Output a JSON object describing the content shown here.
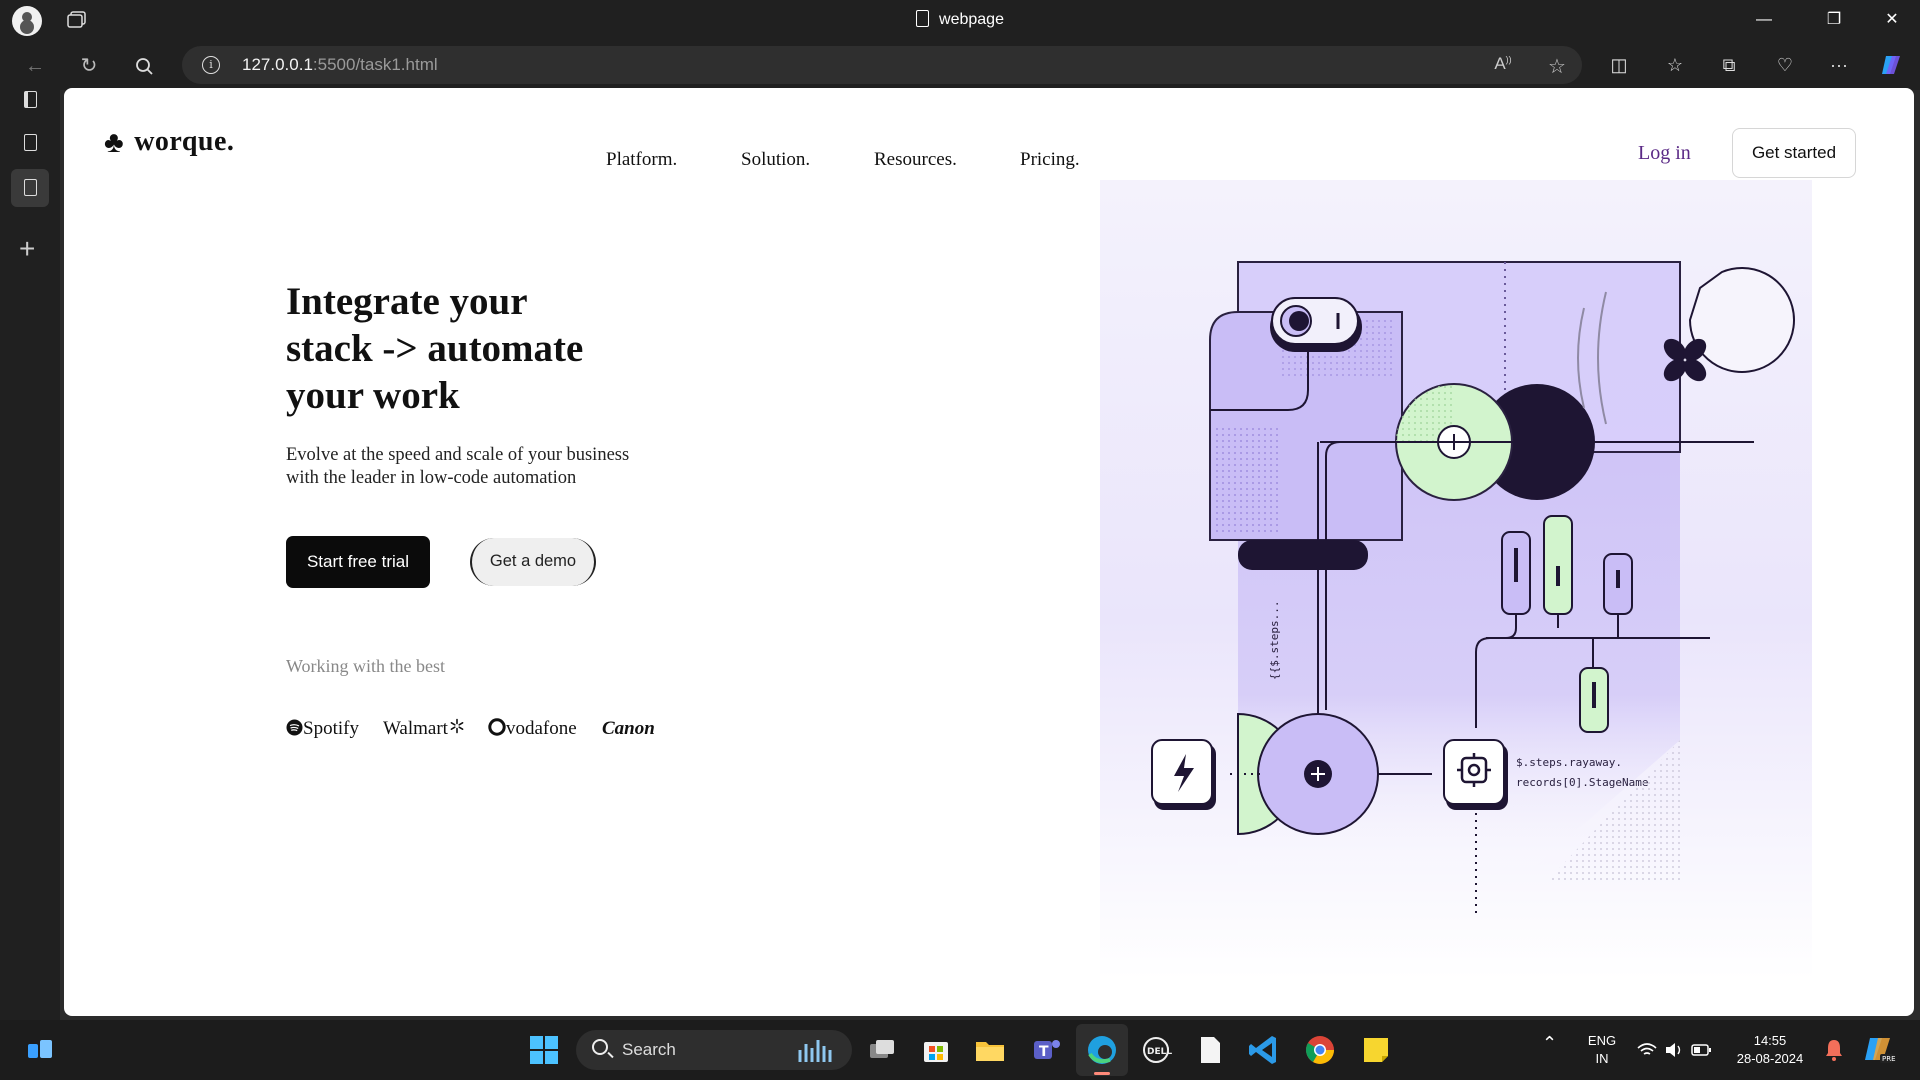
{
  "browser": {
    "tab_title": "webpage",
    "url_host": "127.0.0.1",
    "url_path": ":5500/task1.html",
    "window_controls": [
      "—",
      "❐",
      "✕"
    ]
  },
  "site": {
    "logo_text": "worque.",
    "nav": [
      "Platform.",
      "Solution.",
      "Resources.",
      "Pricing."
    ],
    "login_label": "Log in",
    "get_started_label": "Get started",
    "hero": {
      "title_lines": [
        "Integrate your",
        "stack -> automate",
        "your work"
      ],
      "subtitle_lines": [
        "Evolve at the speed and scale of your business",
        "with the leader in low-code automation"
      ],
      "primary_cta": "Start free trial",
      "secondary_cta": "Get a demo"
    },
    "partners_heading": "Working with the best",
    "partners": [
      "Spotify",
      "Walmart",
      "vodafone",
      "Canon"
    ],
    "illustration": {
      "code_vertical": "{{$.steps...",
      "code_line1": "$.steps.rayaway.",
      "code_line2": "records[0].StageName"
    }
  },
  "taskbar": {
    "search_label": "Search",
    "lang_top": "ENG",
    "lang_bottom": "IN",
    "time": "14:55",
    "date": "28-08-2024"
  },
  "colors": {
    "accent_purple": "#5b2a86",
    "lavender": "#c5b8f5",
    "mint": "#cdf5c9",
    "dark_navy": "#1e1533"
  }
}
